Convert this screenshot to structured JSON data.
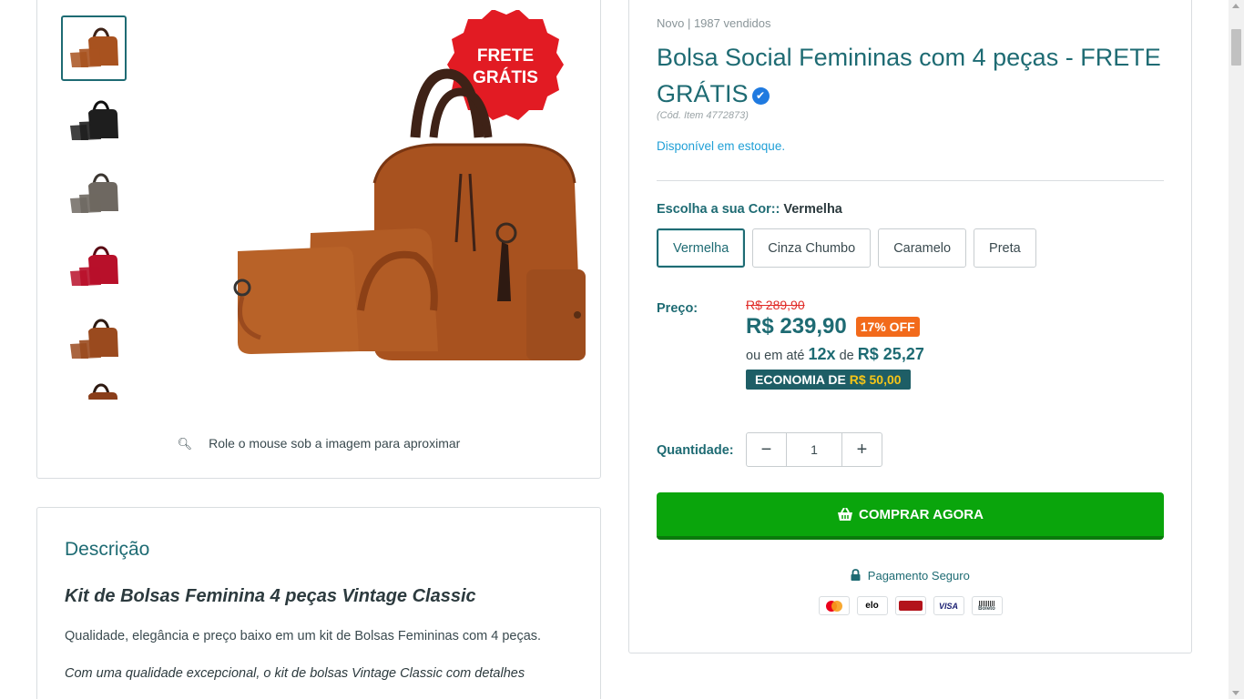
{
  "gallery": {
    "thumbnails": [
      {
        "color": "caramel",
        "bag": "#a8521f",
        "handle": "#3e2217"
      },
      {
        "color": "black",
        "bag": "#1e1e1e",
        "handle": "#111111"
      },
      {
        "color": "gray",
        "bag": "#6e6861",
        "handle": "#3b3631"
      },
      {
        "color": "red",
        "bag": "#b8102a",
        "handle": "#5a0a14"
      },
      {
        "color": "caramel-single",
        "bag": "#9a4a1e",
        "handle": "#2e1a12"
      },
      {
        "color": "partial",
        "bag": "#8a3e1a",
        "handle": "#2e1a12"
      }
    ],
    "badge_line1": "FRETE",
    "badge_line2": "GRÁTIS",
    "zoom_hint": "Role o mouse sob a imagem para aproximar"
  },
  "description": {
    "title": "Descrição",
    "heading": "Kit de Bolsas Feminina 4 peças Vintage Classic",
    "paragraph1": "Qualidade, elegância e preço baixo em um kit de Bolsas Femininas com 4 peças.",
    "paragraph2": "Com uma qualidade excepcional, o kit de bolsas Vintage Classic com detalhes"
  },
  "product": {
    "meta": "Novo | 1987 vendidos",
    "title": "Bolsa Social Femininas com 4 peças - FRETE GRÁTIS",
    "verified_icon": "check-badge-icon",
    "sku": "(Cód. Item 4772873)",
    "stock": "Disponível em estoque.",
    "color_label": "Escolha a sua Cor::",
    "color_selected": "Vermelha",
    "colors": [
      "Vermelha",
      "Cinza Chumbo",
      "Caramelo",
      "Preta"
    ],
    "price_label": "Preço:",
    "old_price": "R$ 289,90",
    "new_price": "R$ 239,90",
    "discount": "17% OFF",
    "installments_prefix": "ou em até",
    "installments_count": "12x",
    "installments_mid": "de",
    "installments_value": "R$ 25,27",
    "economy_label": "ECONOMIA DE",
    "economy_value": "R$ 50,00",
    "qty_label": "Quantidade:",
    "qty_value": "1",
    "buy_label": "COMPRAR AGORA",
    "secure_label": "Pagamento Seguro",
    "payment_methods": [
      "mastercard",
      "elo",
      "hipercard",
      "VISA",
      "Boleto"
    ]
  },
  "colors": {
    "accent": "#1e6b73",
    "buy": "#0aa50c",
    "sale": "#e02b27",
    "badge": "#f26a1b"
  }
}
